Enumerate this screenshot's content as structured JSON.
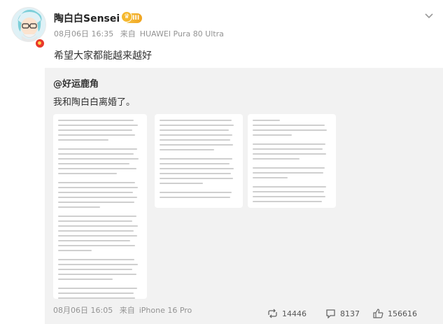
{
  "author": {
    "name": "陶白白Sensei",
    "level": "III"
  },
  "post": {
    "date": "08月06日 16:35",
    "source_prefix": "来自",
    "source_device": "HUAWEI Pura 80 Ultra",
    "text": "希望大家都能越来越好"
  },
  "repost": {
    "user": "@好运鹿角",
    "text": "我和陶白白离婚了。",
    "date": "08月06日 16:05",
    "source_prefix": "来自",
    "source_device": "iPhone 16 Pro",
    "actions": {
      "repost_count": "14446",
      "comment_count": "8137",
      "like_count": "156616"
    }
  },
  "colors": {
    "accent_red": "#e8382b",
    "meta_gray": "#939393",
    "repost_bg": "#f2f2f2"
  },
  "icons": [
    "chevron-down-icon",
    "verified-badge-icon",
    "repost-icon",
    "comment-icon",
    "like-icon"
  ]
}
